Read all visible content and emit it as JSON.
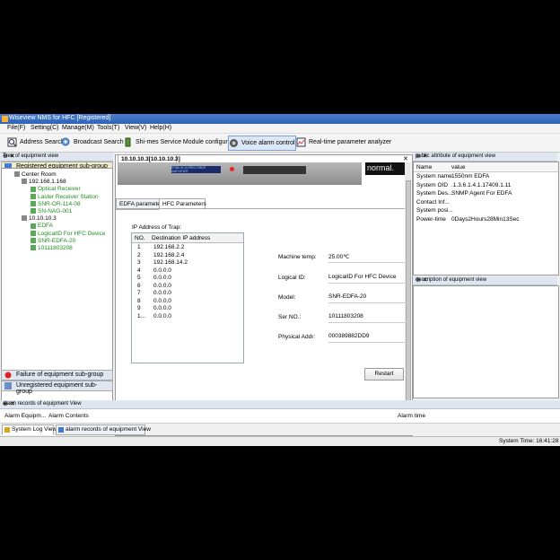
{
  "window": {
    "title": "Wiseview NMS for HFC  [Registered]"
  },
  "menu": [
    "File(F)",
    "Setting(C)",
    "Manage(M)",
    "Tools(T)",
    "View(V)",
    "Help(H)"
  ],
  "toolbar": [
    {
      "label": "Address Search",
      "icon": "address-search-icon"
    },
    {
      "label": "Broadcast Search",
      "icon": "broadcast-search-icon"
    },
    {
      "label": "Shi-mes Service Module configuration",
      "icon": "module-config-icon"
    },
    {
      "label": "Voice alarm control",
      "icon": "voice-alarm-icon"
    },
    {
      "label": "Real-time parameter analyzer",
      "icon": "analyzer-icon"
    }
  ],
  "tree_panel": {
    "title": "Tree of equipment view",
    "registered_group": "Registered equipment sub-group",
    "failure_group": "Failure of equipment sub-group",
    "unregistered_group": "Unregistered equipment sub-group",
    "nodes": [
      {
        "label": "Center Room",
        "level": 0,
        "color": "black"
      },
      {
        "label": "192.168.1.168",
        "level": 1,
        "color": "black"
      },
      {
        "label": "Optical Receiver",
        "level": 2,
        "color": "green"
      },
      {
        "label": "Laster Receiver Station",
        "level": 2,
        "color": "green"
      },
      {
        "label": "SNR-OR-114-08",
        "level": 2,
        "color": "green"
      },
      {
        "label": "SN-NAG-001",
        "level": 2,
        "color": "green"
      },
      {
        "label": "10.10.10.3",
        "level": 1,
        "color": "black"
      },
      {
        "label": "EDFA",
        "level": 2,
        "color": "green"
      },
      {
        "label": "LogicalID For HFC Device",
        "level": 2,
        "color": "green"
      },
      {
        "label": "SNR-EDFA-20",
        "level": 2,
        "color": "green"
      },
      {
        "label": "10111803208",
        "level": 2,
        "color": "green"
      }
    ]
  },
  "doc_tab": "10.10.10.3[10.10.10.3]",
  "device_panel": {
    "lcd_text": "ERBIUM DOPED FIBER AMPLIFIER",
    "status_text": "normal."
  },
  "param_tabs": [
    "EDFA parameters",
    "HFC Parameters"
  ],
  "trap": {
    "title": "IP Address of Trap:",
    "columns": [
      "NO.",
      "Destination IP address"
    ],
    "rows": [
      [
        "1",
        "192.168.2.2"
      ],
      [
        "2",
        "192.168.2.4"
      ],
      [
        "3",
        "192.168.14.2"
      ],
      [
        "4",
        "0.0.0.0"
      ],
      [
        "5",
        "0.0.0.0"
      ],
      [
        "6",
        "0.0.0.0"
      ],
      [
        "7",
        "0.0.0.0"
      ],
      [
        "8",
        "0.0.0.0"
      ],
      [
        "9",
        "0.0.0.0"
      ],
      [
        "1...",
        "0.0.0.0"
      ]
    ]
  },
  "fields": [
    {
      "label": "Machine temp:",
      "value": "25.00℃"
    },
    {
      "label": "Logical ID:",
      "value": "LogicalID For HFC Device"
    },
    {
      "label": "Model:",
      "value": "SNR-EDFA-20"
    },
    {
      "label": "Ser NO.:",
      "value": "10111803208"
    },
    {
      "label": "Physical Addr:",
      "value": "000389882DD9"
    }
  ],
  "restart_label": "Restart",
  "public_attr": {
    "title": "public attribute of equipment view",
    "columns": [
      "Name",
      "value"
    ],
    "rows": [
      [
        "System name",
        "1550nm EDFA"
      ],
      [
        "System OID",
        ".1.3.6.1.4.1.17409.1.11"
      ],
      [
        "System Des...",
        "SNMP Agent For EDFA"
      ],
      [
        "Contact Inf...",
        ""
      ],
      [
        "System posi...",
        ""
      ],
      [
        "Power-time",
        "0Days2Hours28Min13Sec"
      ]
    ]
  },
  "description_title": "description of equipment view",
  "alarm_panel": {
    "title": "alarm records of equipment View",
    "columns": [
      "Alarm Equipm...",
      "Alarm Contents",
      "Alarm time"
    ],
    "tabs": [
      "System Log View",
      "alarm records of equipment View"
    ]
  },
  "status": {
    "time": "System Time: 16:41:28"
  },
  "colors": {
    "title_bar": "#2f62b5",
    "group_header": "#f0ebc8",
    "tree_green": "#1f8a1f",
    "panel_head": "#dfe6ef"
  }
}
